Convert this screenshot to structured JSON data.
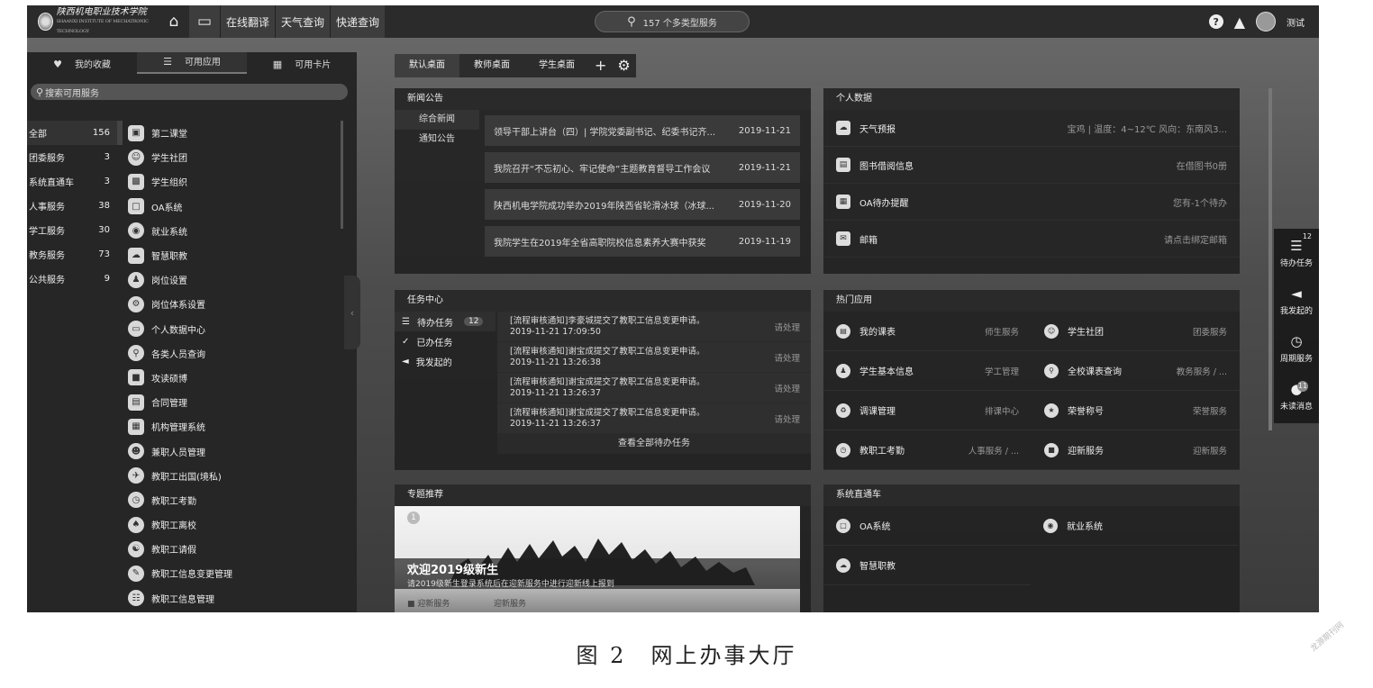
{
  "header": {
    "school_name": "陕西机电职业技术学院",
    "school_name_en": "SHAANXI INSTITUTE OF MECHATRONIC TECHNOLOGY",
    "nav": [
      "在线翻译",
      "天气查询",
      "快递查询"
    ],
    "search_text": "157 个多类型服务",
    "user_name": "测试"
  },
  "sidebar": {
    "tabs": [
      "我的收藏",
      "可用应用",
      "可用卡片"
    ],
    "search_placeholder": "搜索可用服务",
    "categories": [
      {
        "name": "全部",
        "count": "156"
      },
      {
        "name": "团委服务",
        "count": "3"
      },
      {
        "name": "系统直通车",
        "count": "3"
      },
      {
        "name": "人事服务",
        "count": "38"
      },
      {
        "name": "学工服务",
        "count": "30"
      },
      {
        "name": "教务服务",
        "count": "73"
      },
      {
        "name": "公共服务",
        "count": "9"
      }
    ],
    "apps": [
      "第二课堂",
      "学生社团",
      "学生组织",
      "OA系统",
      "就业系统",
      "智慧职教",
      "岗位设置",
      "岗位体系设置",
      "个人数据中心",
      "各类人员查询",
      "攻读硕博",
      "合同管理",
      "机构管理系统",
      "兼职人员管理",
      "教职工出国(境私)",
      "教职工考勤",
      "教职工离校",
      "教职工请假",
      "教职工信息变更管理",
      "教职工信息管理"
    ]
  },
  "desktop_tabs": [
    "默认桌面",
    "教师桌面",
    "学生桌面"
  ],
  "news": {
    "title": "新闻公告",
    "tabs": [
      "综合新闻",
      "通知公告"
    ],
    "items": [
      {
        "text": "领导干部上讲台（四）| 学院党委副书记、纪委书记齐...",
        "date": "2019-11-21"
      },
      {
        "text": "我院召开“不忘初心、牢记使命”主题教育督导工作会议",
        "date": "2019-11-21"
      },
      {
        "text": "陕西机电学院成功举办2019年陕西省轮滑冰球（冰球...",
        "date": "2019-11-20"
      },
      {
        "text": "我院学生在2019年全省高职院校信息素养大赛中获奖",
        "date": "2019-11-19"
      }
    ]
  },
  "personal": {
    "title": "个人数据",
    "rows": [
      {
        "label": "天气预报",
        "value": "宝鸡 | 温度：4~12℃ 风向：东南风3..."
      },
      {
        "label": "图书借阅信息",
        "value": "在借图书0册"
      },
      {
        "label": "OA待办提醒",
        "value": "您有-1个待办"
      },
      {
        "label": "邮箱",
        "value": "请点击绑定邮箱"
      }
    ]
  },
  "tasks": {
    "title": "任务中心",
    "nav": [
      {
        "label": "待办任务",
        "badge": "12"
      },
      {
        "label": "已办任务",
        "badge": ""
      },
      {
        "label": "我发起的",
        "badge": ""
      }
    ],
    "items": [
      {
        "title": "[流程审核通知]李豪城提交了教职工信息变更申请。",
        "time": "2019-11-21 17:09:50",
        "action": "请处理"
      },
      {
        "title": "[流程审核通知]谢宝成提交了教职工信息变更申请。",
        "time": "2019-11-21 13:26:38",
        "action": "请处理"
      },
      {
        "title": "[流程审核通知]谢宝成提交了教职工信息变更申请。",
        "time": "2019-11-21 13:26:37",
        "action": "请处理"
      },
      {
        "title": "[流程审核通知]谢宝成提交了教职工信息变更申请。",
        "time": "2019-11-21 13:26:37",
        "action": "请处理"
      }
    ],
    "more": "查看全部待办任务"
  },
  "hot_apps": {
    "title": "热门应用",
    "items": [
      {
        "name": "我的课表",
        "category": "师生服务"
      },
      {
        "name": "学生社团",
        "category": "团委服务"
      },
      {
        "name": "学生基本信息",
        "category": "学工管理"
      },
      {
        "name": "全校课表查询",
        "category": "教务服务 / ..."
      },
      {
        "name": "调课管理",
        "category": "排课中心"
      },
      {
        "name": "荣誉称号",
        "category": "荣誉服务"
      },
      {
        "name": "教职工考勤",
        "category": "人事服务 / ..."
      },
      {
        "name": "迎新服务",
        "category": "迎新服务"
      }
    ]
  },
  "topic": {
    "title": "专题推荐",
    "badge": "1",
    "banner_title": "欢迎2019级新生",
    "banner_sub": "请2019级新生登录系统后在迎新服务中进行迎新线上报到",
    "bottom_left": "迎新服务",
    "bottom_right": "迎新服务"
  },
  "express": {
    "title": "系统直通车",
    "items": [
      "OA系统",
      "就业系统",
      "智慧职教"
    ]
  },
  "float_bar": [
    {
      "label": "待办任务",
      "badge": "12"
    },
    {
      "label": "我发起的",
      "badge": ""
    },
    {
      "label": "周期服务",
      "badge": ""
    },
    {
      "label": "未读消息",
      "badge": "11"
    }
  ],
  "caption": "图 2　网上办事大厅",
  "watermark": "龙源期刊网"
}
